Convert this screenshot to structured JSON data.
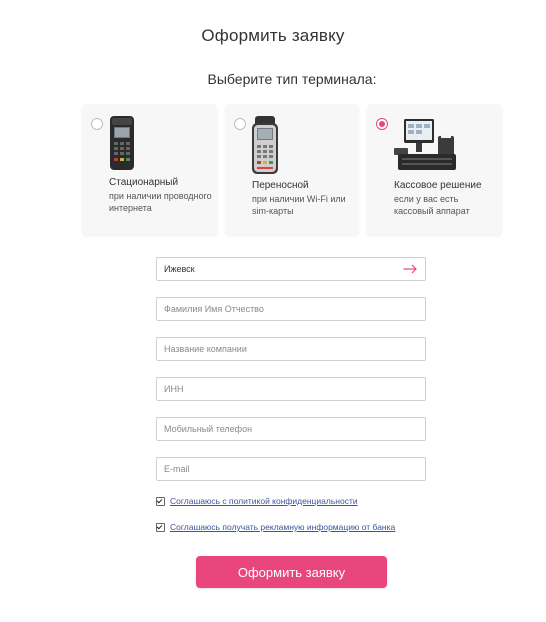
{
  "form": {
    "title": "Оформить заявку",
    "subtitle": "Выберите тип терминала:"
  },
  "terminals": [
    {
      "title": "Стационарный",
      "description": "при наличии проводного интернета",
      "selected": false,
      "icon": "stationary-terminal-icon"
    },
    {
      "title": "Переносной",
      "description": "при наличии Wi-Fi или sim-карты",
      "selected": false,
      "icon": "portable-terminal-icon"
    },
    {
      "title": "Кассовое решение",
      "description": "если у вас есть кассовый аппарат",
      "selected": true,
      "icon": "pos-register-icon"
    }
  ],
  "fields": {
    "city": {
      "value": "Ижевск",
      "placeholder": ""
    },
    "full_name": {
      "value": "",
      "placeholder": "Фамилия Имя Отчество"
    },
    "company": {
      "value": "",
      "placeholder": "Название компании"
    },
    "inn": {
      "value": "",
      "placeholder": "ИНН"
    },
    "phone": {
      "value": "",
      "placeholder": "Мобильный телефон"
    },
    "email": {
      "value": "",
      "placeholder": "E-mail"
    }
  },
  "consents": [
    {
      "label": "Соглашаюсь с политикой конфиденциальности",
      "checked": true
    },
    {
      "label": "Соглашаюсь получать рекламную информацию от банка",
      "checked": true
    }
  ],
  "submit_label": "Оформить заявку",
  "colors": {
    "accent": "#e8467c",
    "card_bg": "#f7f7f7",
    "link": "#3a55a0",
    "border": "#cfcfcf"
  }
}
